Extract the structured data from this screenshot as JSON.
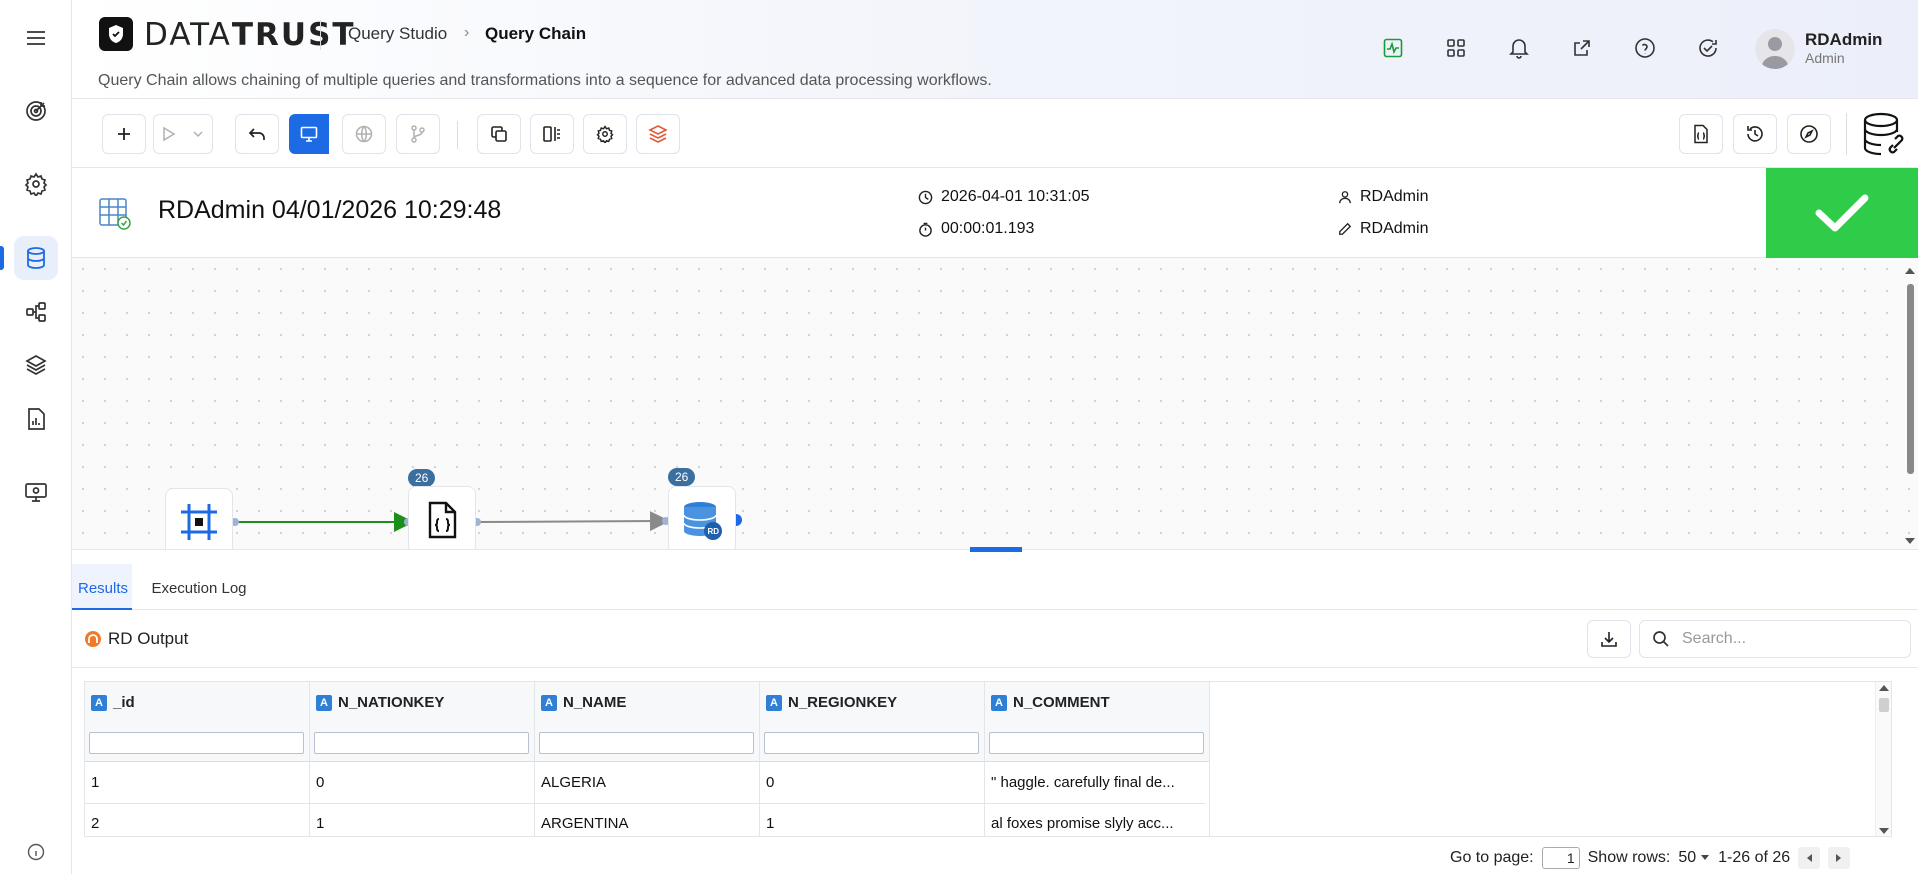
{
  "brand": {
    "name_light": "DATA",
    "name_bold": "TRUST"
  },
  "breadcrumb": {
    "parent": "Query Studio",
    "current": "Query Chain"
  },
  "header": {
    "subtitle": "Query Chain allows chaining of multiple queries and transformations into a sequence for advanced data processing workflows.",
    "user_name": "RDAdmin",
    "user_role": "Admin"
  },
  "run": {
    "title": "RDAdmin 04/01/2026 10:29:48",
    "timestamp": "2026-04-01 10:31:05",
    "duration": "00:00:01.193",
    "created_by": "RDAdmin",
    "modified_by": "RDAdmin",
    "status": "success"
  },
  "canvas": {
    "nodes": [
      {
        "name": "source-node",
        "icon": "frame-stop-icon",
        "badge": ""
      },
      {
        "name": "query-node",
        "icon": "json-file-icon",
        "badge": "26"
      },
      {
        "name": "output-node",
        "icon": "rd-database-icon",
        "badge": "26"
      }
    ]
  },
  "tabs": {
    "results": "Results",
    "execution_log": "Execution Log"
  },
  "output": {
    "label": "RD Output",
    "search_placeholder": "Search..."
  },
  "table": {
    "columns": [
      "_id",
      "N_NATIONKEY",
      "N_NAME",
      "N_REGIONKEY",
      "N_COMMENT"
    ],
    "column_type_glyph": "A",
    "rows": [
      [
        "1",
        "0",
        "ALGERIA",
        "0",
        "\" haggle. carefully final de..."
      ],
      [
        "2",
        "1",
        "ARGENTINA",
        "1",
        "al foxes promise slyly acc..."
      ]
    ]
  },
  "pager": {
    "goto_label": "Go to page:",
    "page": "1",
    "show_rows_label": "Show rows:",
    "rows_per_page": "50",
    "range": "1-26 of 26"
  },
  "colors": {
    "accent": "#1d6ae5",
    "success": "#2ecc48",
    "badge": "#3b6fa0",
    "edge_active": "#1a8f1a"
  }
}
